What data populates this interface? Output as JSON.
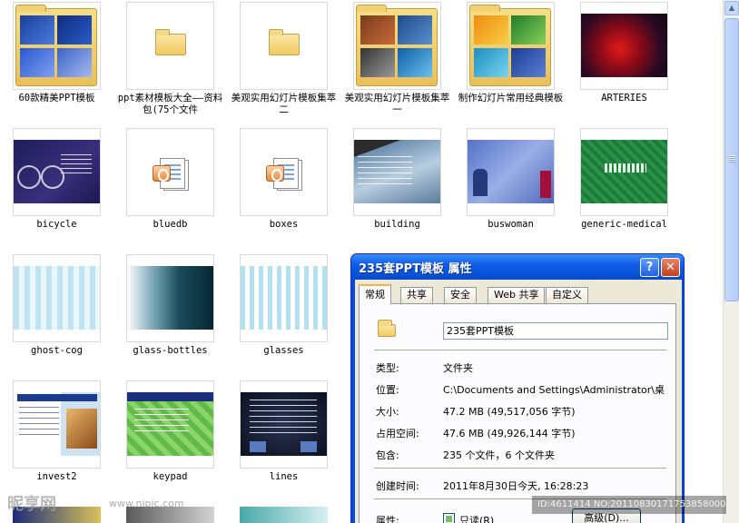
{
  "files": [
    {
      "label": "60款精美PPT模板",
      "kind": "folder-preview"
    },
    {
      "label": "ppt素材模板大全——资料包(75个文件",
      "kind": "folder"
    },
    {
      "label": "美观实用幻灯片模板集萃 二",
      "kind": "folder"
    },
    {
      "label": "美观实用幻灯片模板集萃 一",
      "kind": "folder-preview"
    },
    {
      "label": "制作幻灯片常用经典模板",
      "kind": "folder-preview"
    },
    {
      "label": "ARTERIES",
      "kind": "image"
    },
    {
      "label": "bicycle",
      "kind": "image"
    },
    {
      "label": "bluedb",
      "kind": "ppt"
    },
    {
      "label": "boxes",
      "kind": "ppt"
    },
    {
      "label": "building",
      "kind": "image"
    },
    {
      "label": "buswoman",
      "kind": "image"
    },
    {
      "label": "generic-medical",
      "kind": "image"
    },
    {
      "label": "ghost-cog",
      "kind": "image"
    },
    {
      "label": "glass-bottles",
      "kind": "image"
    },
    {
      "label": "glasses",
      "kind": "image"
    },
    {
      "label": "invest2",
      "kind": "image"
    },
    {
      "label": "keypad",
      "kind": "image"
    },
    {
      "label": "lines",
      "kind": "image"
    }
  ],
  "dialog": {
    "title": "235套PPT模板 属性",
    "help_glyph": "?",
    "close_glyph": "✕",
    "tabs": [
      "常规",
      "共享",
      "安全",
      "Web 共享",
      "自定义"
    ],
    "active_tab": "常规",
    "name": "235套PPT模板",
    "fields": [
      {
        "label": "类型:",
        "value": "文件夹"
      },
      {
        "label": "位置:",
        "value": "C:\\Documents and Settings\\Administrator\\桌"
      },
      {
        "label": "大小:",
        "value": "47.2 MB (49,517,056 字节)"
      },
      {
        "label": "占用空间:",
        "value": "47.6 MB (49,926,144 字节)"
      },
      {
        "label": "包含:",
        "value": "235 个文件，6 个文件夹"
      },
      {
        "label": "创建时间:",
        "value": "2011年8月30日今天, 16:28:23"
      }
    ],
    "attributes_label": "属性:",
    "readonly_label": "只读(R)",
    "advanced_button": "高级(D)..."
  },
  "watermark": {
    "logo": "昵享网",
    "url": "www.nipic.com",
    "id": "ID:4611414 NO:20110830171753858000"
  },
  "icons": {
    "folder": "folder-icon",
    "ppt": "powerpoint-file-icon",
    "scroll_up": "scroll-up-arrow-icon"
  }
}
